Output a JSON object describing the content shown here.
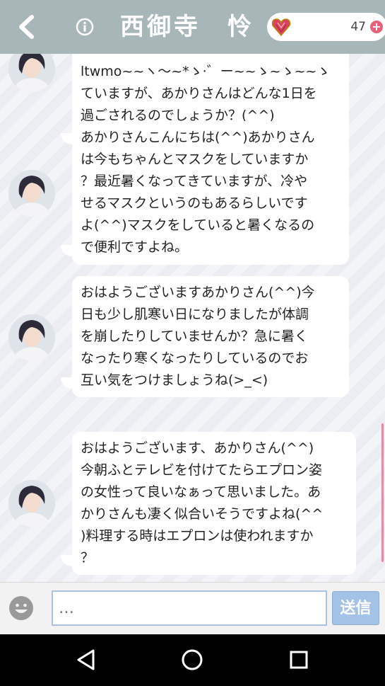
{
  "header": {
    "title": "西御寺　怜",
    "gem_count": "47",
    "plus_label": "+"
  },
  "messages": [
    {
      "text": "ltwmo~~ヽ～~*ゝ·゛ー~~ゝ~ゝ~~ゝ\nていますが、あかりさんはどんな1日を\n過ごされるのでしょうか？(^^)"
    },
    {
      "text": "あかりさんこんにちは(^^)あかりさん\nは今もちゃんとマスクをしていますか\n？最近暑くなってきていますが、冷や\nせるマスクというのもあるらしいです\nよ(^^)マスクをしていると暑くなるの\nで便利ですよね。"
    },
    {
      "text": "おはようございますあかりさん(^^)今\n日も少し肌寒い日になりましたが体調\nを崩したりしていませんか？急に暑く\nなったり寒くなったりしているのでお\n互い気をつけましょうね(>_<)"
    },
    {
      "text": "おはようございます、あかりさん(^^)\n今朝ふとテレビを付けてたらエプロン姿\nの女性って良いなぁって思いました。あ\nかりさんも凄く似合いそうですよね(^^\n)料理する時はエプロンは使われますか\n？"
    }
  ],
  "input": {
    "placeholder": "…",
    "send_label": "送信"
  },
  "colors": {
    "header_bg": "#a7b6b9",
    "send_bg": "#a4c2e6",
    "accent_pink": "#e9607a"
  }
}
